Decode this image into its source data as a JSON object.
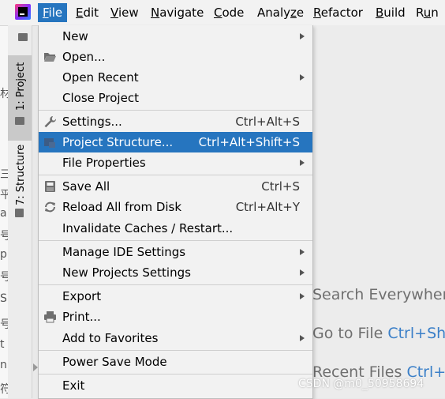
{
  "menubar": {
    "items": [
      {
        "label": "File",
        "mnemonic": "F",
        "rest": "ile"
      },
      {
        "label": "Edit",
        "mnemonic": "E",
        "rest": "dit"
      },
      {
        "label": "View",
        "mnemonic": "V",
        "rest": "iew"
      },
      {
        "label": "Navigate",
        "mnemonic": "N",
        "rest": "avigate"
      },
      {
        "label": "Code",
        "mnemonic": "C",
        "rest": "ode"
      },
      {
        "label": "Analyze",
        "pre": "Analy",
        "mnemonic": "z",
        "rest": "e"
      },
      {
        "label": "Refactor",
        "mnemonic": "R",
        "rest": "efactor"
      },
      {
        "label": "Build",
        "mnemonic": "B",
        "rest": "uild"
      },
      {
        "label": "Run",
        "pre": "R",
        "mnemonic": "u",
        "rest": "n"
      }
    ]
  },
  "toolwindows": {
    "project_tab": "1: Project",
    "structure_tab": "7: Structure"
  },
  "file_menu": {
    "items": [
      {
        "label": "New"
      },
      {
        "label": "Open..."
      },
      {
        "label": "Open Recent"
      },
      {
        "label": "Close Project"
      },
      {
        "label": "Settings...",
        "shortcut": "Ctrl+Alt+S"
      },
      {
        "label": "Project Structure...",
        "shortcut": "Ctrl+Alt+Shift+S"
      },
      {
        "label": "File Properties"
      },
      {
        "label": "Save All",
        "shortcut": "Ctrl+S"
      },
      {
        "label": "Reload All from Disk",
        "shortcut": "Ctrl+Alt+Y"
      },
      {
        "label": "Invalidate Caches / Restart..."
      },
      {
        "label": "Manage IDE Settings"
      },
      {
        "label": "New Projects Settings"
      },
      {
        "label": "Export"
      },
      {
        "label": "Print..."
      },
      {
        "label": "Add to Favorites"
      },
      {
        "label": "Power Save Mode"
      },
      {
        "label": "Exit"
      }
    ]
  },
  "editor_hints": {
    "search": "Search Everywhere",
    "goto_file": "Go to File",
    "goto_file_key": "Ctrl+Shi",
    "recent_files": "Recent Files",
    "recent_files_key": "Ctrl+E"
  },
  "underlying_chars": [
    "材",
    "三",
    "平",
    "a",
    "号",
    "p",
    "号",
    "S",
    "号",
    "t",
    "n.",
    "符"
  ],
  "watermark": "CSDN @m0_50958694",
  "colors": {
    "accent": "#2675bf",
    "hint_key": "#3a7fc8"
  }
}
